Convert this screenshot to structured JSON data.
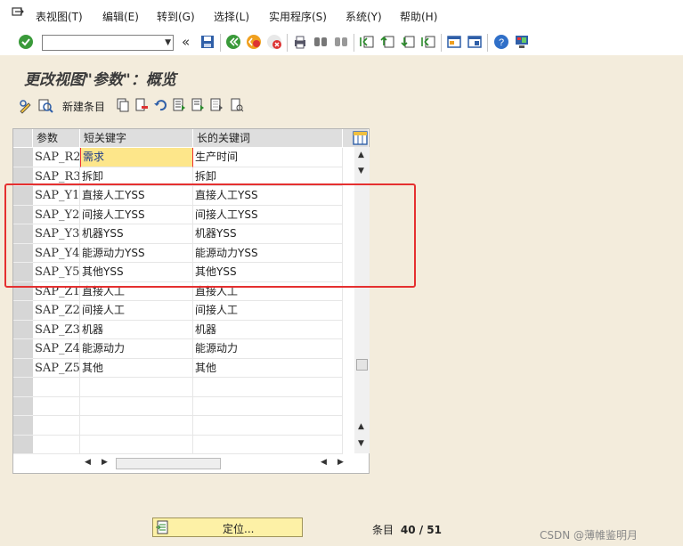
{
  "menu": {
    "items": [
      "表视图(T)",
      "编辑(E)",
      "转到(G)",
      "选择(L)",
      "实用程序(S)",
      "系统(Y)",
      "帮助(H)"
    ]
  },
  "title": "更改视图\"参数\"：概览",
  "app_toolbar": {
    "new_entries_label": "新建条目"
  },
  "table": {
    "columns": [
      "参数",
      "短关键字",
      "长的关键词"
    ],
    "rows": [
      [
        "SAP_R2",
        "需求",
        "生产时间"
      ],
      [
        "SAP_R3",
        "拆卸",
        "拆卸"
      ],
      [
        "SAP_Y1",
        "直接人工YSS",
        "直接人工YSS"
      ],
      [
        "SAP_Y2",
        "间接人工YSS",
        "间接人工YSS"
      ],
      [
        "SAP_Y3",
        "机器YSS",
        "机器YSS"
      ],
      [
        "SAP_Y4",
        "能源动力YSS",
        "能源动力YSS"
      ],
      [
        "SAP_Y5",
        "其他YSS",
        "其他YSS"
      ],
      [
        "SAP_Z1",
        "直接人工",
        "直接人工"
      ],
      [
        "SAP_Z2",
        "间接人工",
        "间接人工"
      ],
      [
        "SAP_Z3",
        "机器",
        "机器"
      ],
      [
        "SAP_Z4",
        "能源动力",
        "能源动力"
      ],
      [
        "SAP_Z5",
        "其他",
        "其他"
      ],
      [
        "",
        "",
        ""
      ],
      [
        "",
        "",
        ""
      ],
      [
        "",
        "",
        ""
      ],
      [
        "",
        "",
        ""
      ]
    ]
  },
  "footer": {
    "position_button": "定位...",
    "entry_label": "条目",
    "entry_value": "40 / 51"
  },
  "watermark": "CSDN @薄帷鉴明月",
  "colors": {
    "highlight_box": "#e53030",
    "active_cell": "#fde68a",
    "background": "#f3ecdc"
  }
}
